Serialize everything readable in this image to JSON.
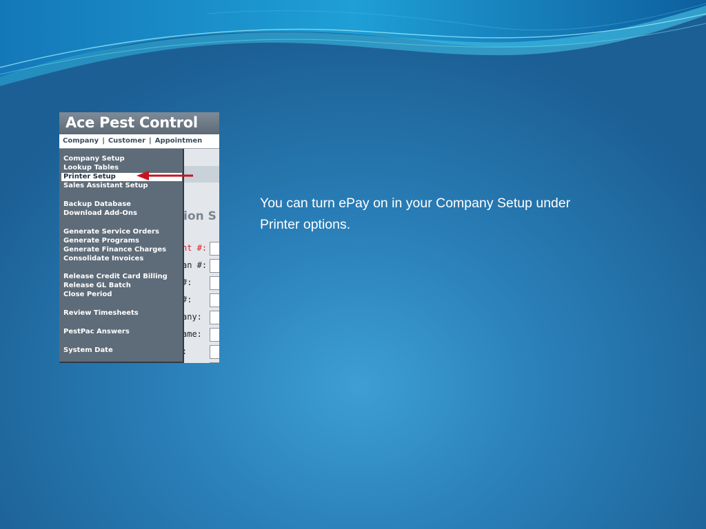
{
  "app": {
    "title": "Ace Pest Control",
    "nav": [
      "Company",
      "Customer",
      "Appointmen"
    ]
  },
  "form": {
    "heading": "tion S",
    "labels": [
      "nt #:",
      "an #:",
      "#:",
      "#:",
      "any:",
      "ame:",
      ":"
    ]
  },
  "menu": {
    "items": [
      "Company Setup",
      "Lookup Tables",
      "Printer Setup",
      "Sales Assistant Setup",
      "Backup Database",
      "Download Add-Ons",
      "Generate Service Orders",
      "Generate Programs",
      "Generate Finance Charges",
      "Consolidate Invoices",
      "Release Credit Card Billing",
      "Release GL Batch",
      "Close Period",
      "Review Timesheets",
      "PestPac Answers",
      "System Date"
    ],
    "selected": "Printer Setup"
  },
  "caption": "You can turn ePay on in your Company Setup under Printer options.",
  "colors": {
    "arrow": "#c8141e",
    "highlight_label": "#d82020"
  }
}
